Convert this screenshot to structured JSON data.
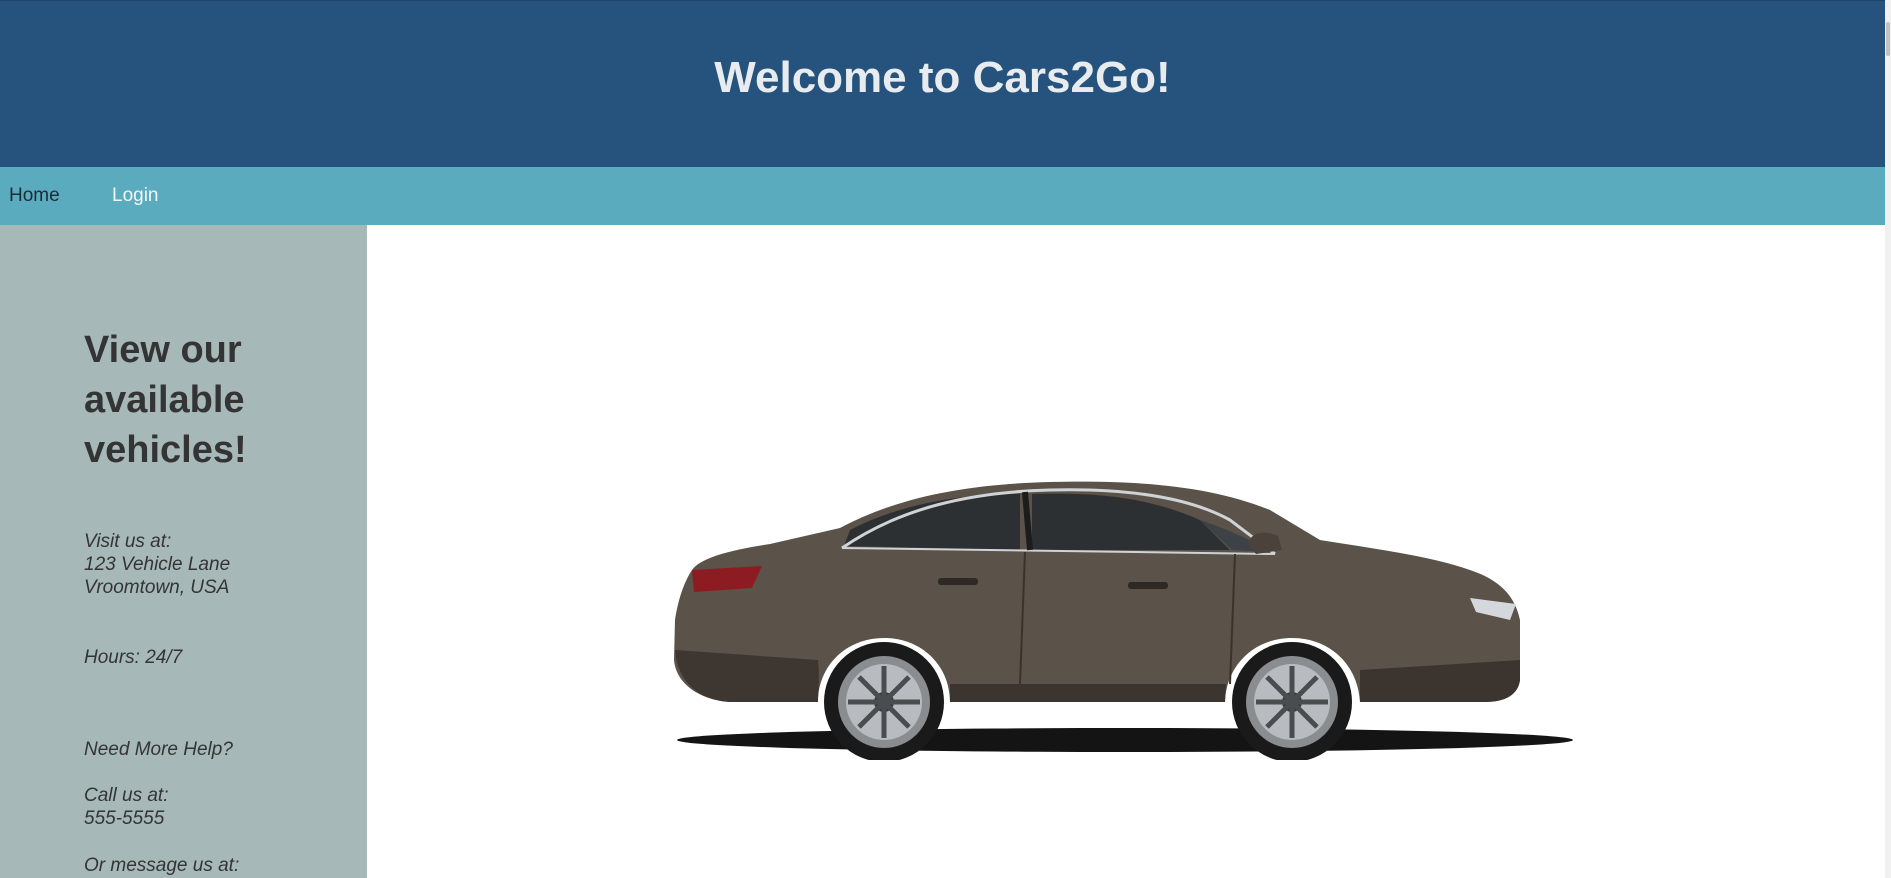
{
  "header": {
    "title": "Welcome to Cars2Go!"
  },
  "nav": {
    "items": [
      {
        "label": "Home"
      },
      {
        "label": "Login"
      }
    ]
  },
  "sidebar": {
    "heading_lines": [
      "View our",
      "available",
      "vehicles!"
    ],
    "visit_label": "Visit us at:",
    "address_line1": "123 Vehicle Lane",
    "address_line2": "Vroomtown, USA",
    "hours": "Hours: 24/7",
    "help": "Need More Help?",
    "call_label": "Call us at:",
    "phone": "555-5555",
    "message_label": "Or message us at:"
  },
  "main": {
    "image_icon": "car-image-icon"
  },
  "colors": {
    "header_bg": "#26537d",
    "nav_bg": "#5babbf",
    "sidebar_bg": "#a6b9b8"
  }
}
